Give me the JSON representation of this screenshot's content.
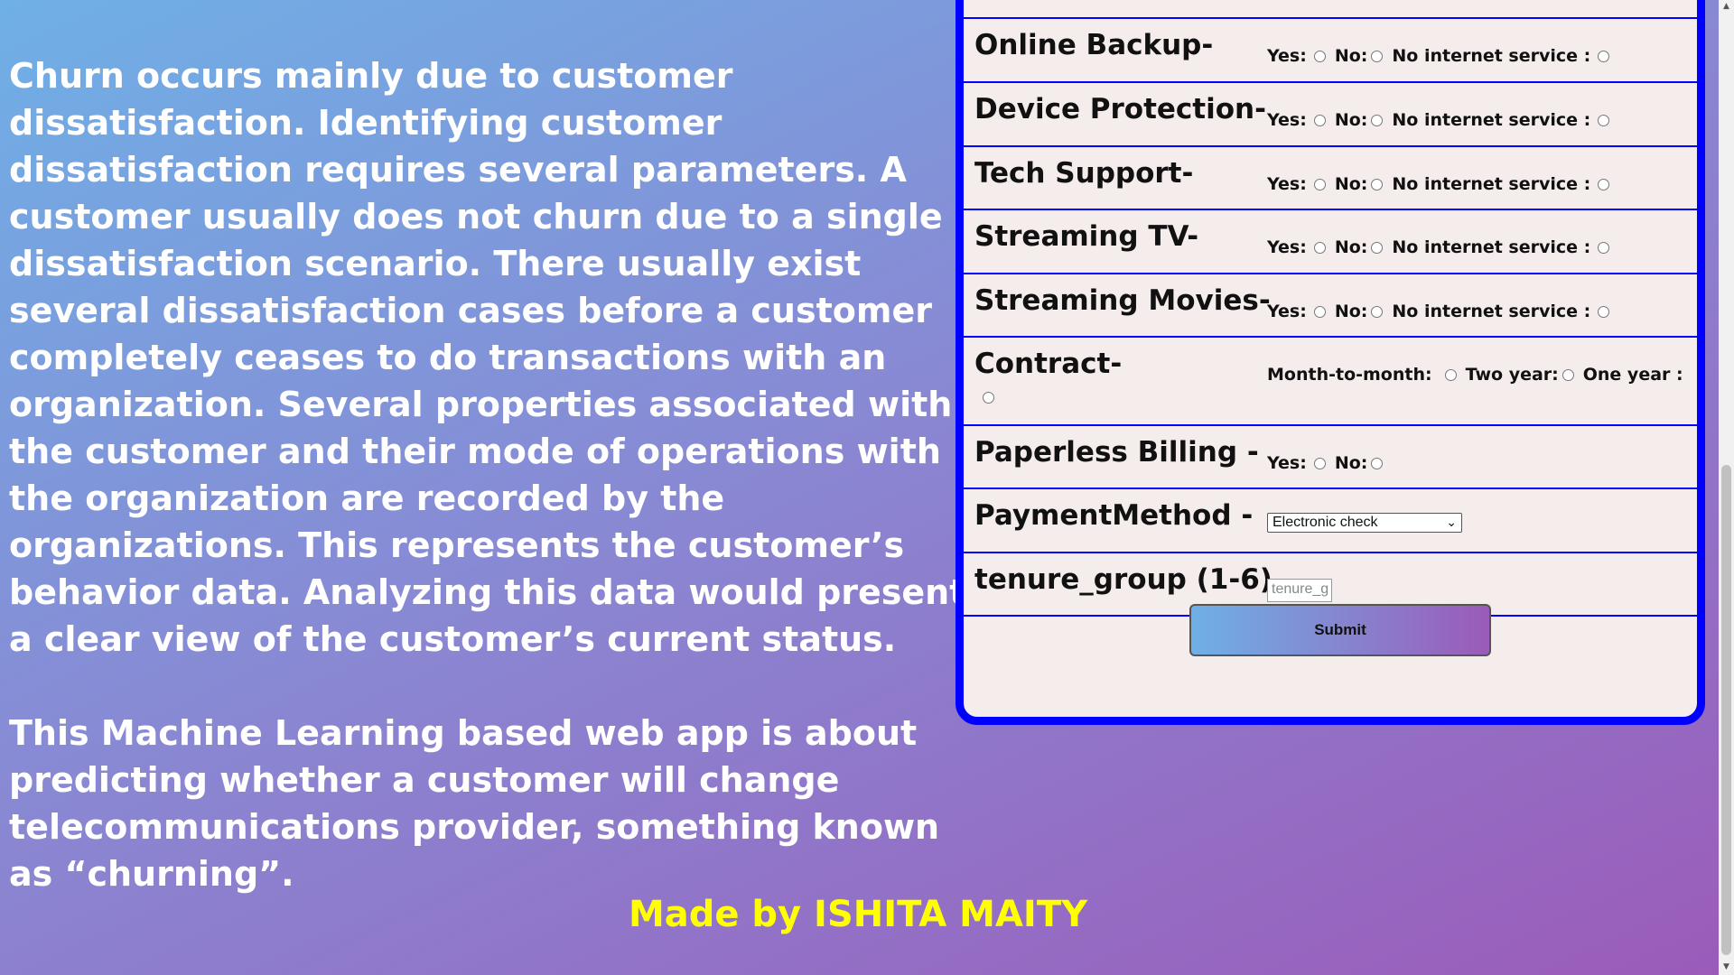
{
  "intro": {
    "paragraph1": "Churn occurs mainly due to customer dissatisfaction. Identifying customer dissatisfaction requires several parameters. A customer usually does not churn due to a single dissatisfaction scenario. There usually exist several dissatisfaction cases before a customer completely ceases to do transactions with an organization. Several properties associated with the customer and their mode of operations with the organization are recorded by the organizations. This represents the customer’s behavior data. Analyzing this data would present a clear view of the customer’s current status.",
    "paragraph2": "This Machine Learning based web app is about predicting whether a customer will change telecommunications provider, something known as “churning”."
  },
  "form": {
    "yes_label": "Yes:",
    "no_label": "No:",
    "no_internet_label": "No internet service :",
    "online_backup": {
      "label": "Online Backup-"
    },
    "device_protection": {
      "label": "Device Protection-"
    },
    "tech_support": {
      "label": "Tech Support-"
    },
    "streaming_tv": {
      "label": "Streaming TV-"
    },
    "streaming_movies": {
      "label": "Streaming Movies-"
    },
    "contract": {
      "label": "Contract-",
      "month_to_month": "Month-to-month:",
      "two_year": "Two year:",
      "one_year": "One year :"
    },
    "paperless_billing": {
      "label": "Paperless Billing -"
    },
    "payment_method": {
      "label": "PaymentMethod -",
      "selected": "Electronic check"
    },
    "tenure_group": {
      "label": "tenure_group (1-6)",
      "placeholder": "tenure_g"
    },
    "submit_label": "Submit"
  },
  "footer": {
    "text": "Made by ISHITA MAITY"
  },
  "colors": {
    "accent_border": "#0000ff",
    "footer_text": "#ffff00"
  },
  "icons": {
    "select_arrow": "chevron-down-icon"
  }
}
